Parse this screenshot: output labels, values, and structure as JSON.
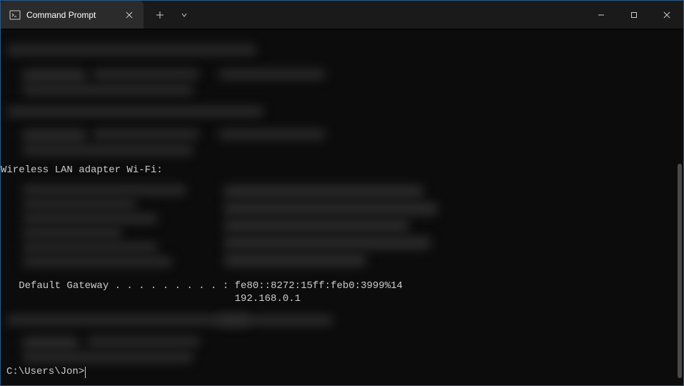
{
  "window": {
    "tab_title": "Command Prompt"
  },
  "terminal": {
    "section_header": "Wireless LAN adapter Wi-Fi:",
    "gateway_label": "   Default Gateway . . . . . . . . . : ",
    "gateway_ipv6": "fe80::8272:15ff:feb0:3999%14",
    "gateway_ipv4": "                                       192.168.0.1",
    "prompt": "C:\\Users\\Jon>"
  }
}
